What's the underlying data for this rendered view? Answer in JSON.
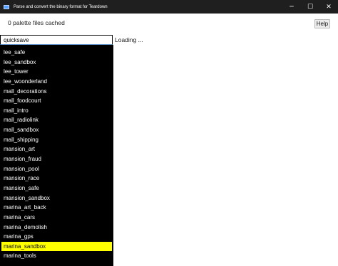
{
  "window": {
    "title": "Parse and convert the binary format for Teardown",
    "minimize": "─",
    "maximize": "☐",
    "close": "✕"
  },
  "header": {
    "cache_status": "0 palette files cached",
    "help_label": "Help"
  },
  "search": {
    "value": "quicksave"
  },
  "list": {
    "items": [
      "lee_safe",
      "lee_sandbox",
      "lee_tower",
      "lee_woonderland",
      "mall_decorations",
      "mall_foodcourt",
      "mall_intro",
      "mall_radiolink",
      "mall_sandbox",
      "mall_shipping",
      "mansion_art",
      "mansion_fraud",
      "mansion_pool",
      "mansion_race",
      "mansion_safe",
      "mansion_sandbox",
      "marina_art_back",
      "marina_cars",
      "marina_demolish",
      "marina_gps",
      "marina_sandbox",
      "marina_tools"
    ],
    "selected_index": 20,
    "selected_color": "#ffff00"
  },
  "main": {
    "status": "Loading ..."
  }
}
